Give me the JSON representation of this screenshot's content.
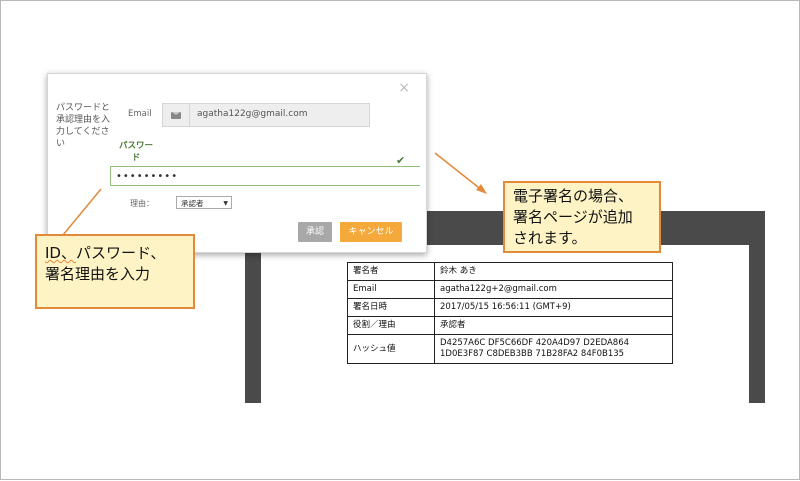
{
  "dialog": {
    "close_glyph": "×",
    "instruction": "パスワードと承認理由を入力してください",
    "email_label": "Email",
    "email_value": "agatha122g@gmail.com",
    "password_label_line1": "パスワー",
    "password_label_line2": "ド",
    "password_value": "•••••••••",
    "reason_label": "理由：",
    "reason_selected": "承認者",
    "approve_button": "承認",
    "cancel_button": "キャンセル"
  },
  "signature_page": {
    "rows": [
      {
        "key": "署名者",
        "value": "鈴木 あき"
      },
      {
        "key": "Email",
        "value": "agatha122g+2@gmail.com"
      },
      {
        "key": "署名日時",
        "value": "2017/05/15 16:56:11 (GMT+9)"
      },
      {
        "key": "役割／理由",
        "value": "承認者"
      },
      {
        "key": "ハッシュ値",
        "value": "D4257A6C DF5C66DF 420A4D97 D2EDA864 1D0E3F87 C8DEB3BB 71B28FA2 84F0B135"
      }
    ]
  },
  "callouts": {
    "left_line1_part1": "ID、",
    "left_line1_part2": "パスワード、",
    "left_line2": "署名理由を入力",
    "right_line1": "電子署名の場合、",
    "right_line2": "署名ページが追加",
    "right_line3": "されます。"
  },
  "colors": {
    "accent_orange": "#e38a3a",
    "callout_fill": "#fdf3c5",
    "cancel_button": "#f5a93b",
    "approve_button": "#a8a8a8",
    "valid_green": "#4a7a3a",
    "document_frame": "#4a4a4a"
  },
  "icons": [
    "envelope-icon",
    "checkmark-icon",
    "close-icon",
    "caret-down-icon"
  ]
}
